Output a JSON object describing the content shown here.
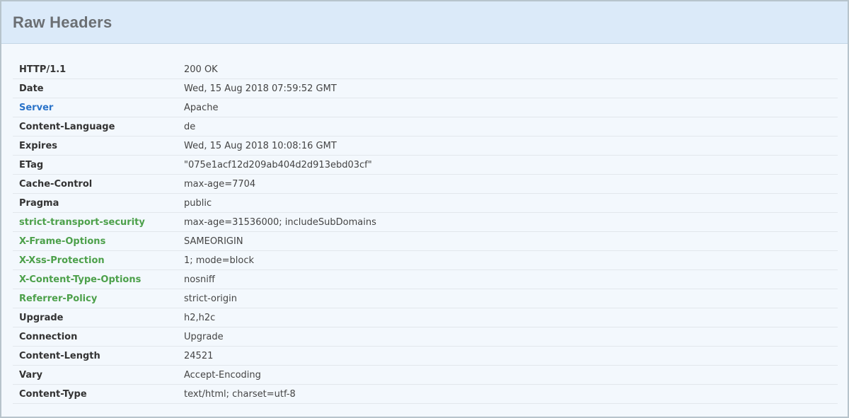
{
  "panel": {
    "title": "Raw Headers"
  },
  "colors": {
    "header_bg": "#dbeaf9",
    "panel_bg": "#f3f8fd",
    "link": "#2a73c9",
    "security": "#4ca04a"
  },
  "headers": [
    {
      "name": "HTTP/1.1",
      "value": "200 OK",
      "style": "plain"
    },
    {
      "name": "Date",
      "value": "Wed, 15 Aug 2018 07:59:52 GMT",
      "style": "plain"
    },
    {
      "name": "Server",
      "value": "Apache",
      "style": "link"
    },
    {
      "name": "Content-Language",
      "value": "de",
      "style": "plain"
    },
    {
      "name": "Expires",
      "value": "Wed, 15 Aug 2018 10:08:16 GMT",
      "style": "plain"
    },
    {
      "name": "ETag",
      "value": "\"075e1acf12d209ab404d2d913ebd03cf\"",
      "style": "plain"
    },
    {
      "name": "Cache-Control",
      "value": "max-age=7704",
      "style": "plain"
    },
    {
      "name": "Pragma",
      "value": "public",
      "style": "plain"
    },
    {
      "name": "strict-transport-security",
      "value": "max-age=31536000; includeSubDomains",
      "style": "good"
    },
    {
      "name": "X-Frame-Options",
      "value": "SAMEORIGIN",
      "style": "good"
    },
    {
      "name": "X-Xss-Protection",
      "value": "1; mode=block",
      "style": "good"
    },
    {
      "name": "X-Content-Type-Options",
      "value": "nosniff",
      "style": "good"
    },
    {
      "name": "Referrer-Policy",
      "value": "strict-origin",
      "style": "good"
    },
    {
      "name": "Upgrade",
      "value": "h2,h2c",
      "style": "plain"
    },
    {
      "name": "Connection",
      "value": "Upgrade",
      "style": "plain"
    },
    {
      "name": "Content-Length",
      "value": "24521",
      "style": "plain"
    },
    {
      "name": "Vary",
      "value": "Accept-Encoding",
      "style": "plain"
    },
    {
      "name": "Content-Type",
      "value": "text/html; charset=utf-8",
      "style": "plain"
    }
  ]
}
